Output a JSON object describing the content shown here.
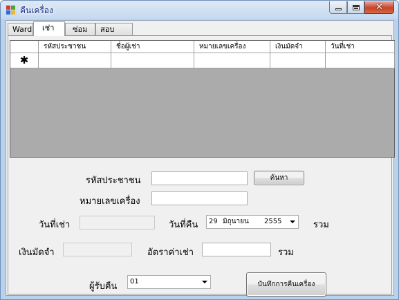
{
  "window": {
    "title": "คืนเครื่อง"
  },
  "tabs": [
    {
      "label": "Ward"
    },
    {
      "label": "เช่า"
    },
    {
      "label": "ซ่อม"
    },
    {
      "label": "สอบเทียบ"
    }
  ],
  "grid": {
    "columns": [
      "รหัสประชาชน",
      "ชื่อผู้เช่า",
      "หมายเลขเครื่อง",
      "เงินมัดจำ",
      "วันที่เช่า"
    ],
    "new_row_marker": "✱"
  },
  "form": {
    "citizen_id_label": "รหัสประชาชน",
    "citizen_id_value": "",
    "search_button": "ค้นหา",
    "device_no_label": "หมายเลขเครื่อง",
    "device_no_value": "",
    "rent_date_label": "วันที่เช่า",
    "rent_date_value": "",
    "return_date_label": "วันที่คืน",
    "return_date": {
      "day": "29",
      "month": "มิถุนายน",
      "year": "2555"
    },
    "total_label_1": "รวม",
    "deposit_label": "เงินมัดจำ",
    "deposit_value": "",
    "rate_label": "อัตราค่าเช่า",
    "rate_value": "",
    "total_label_2": "รวม",
    "receiver_label": "ผู้รับคืน",
    "receiver_value": "01",
    "save_button": "บันทึกการคืนเครื่อง"
  }
}
